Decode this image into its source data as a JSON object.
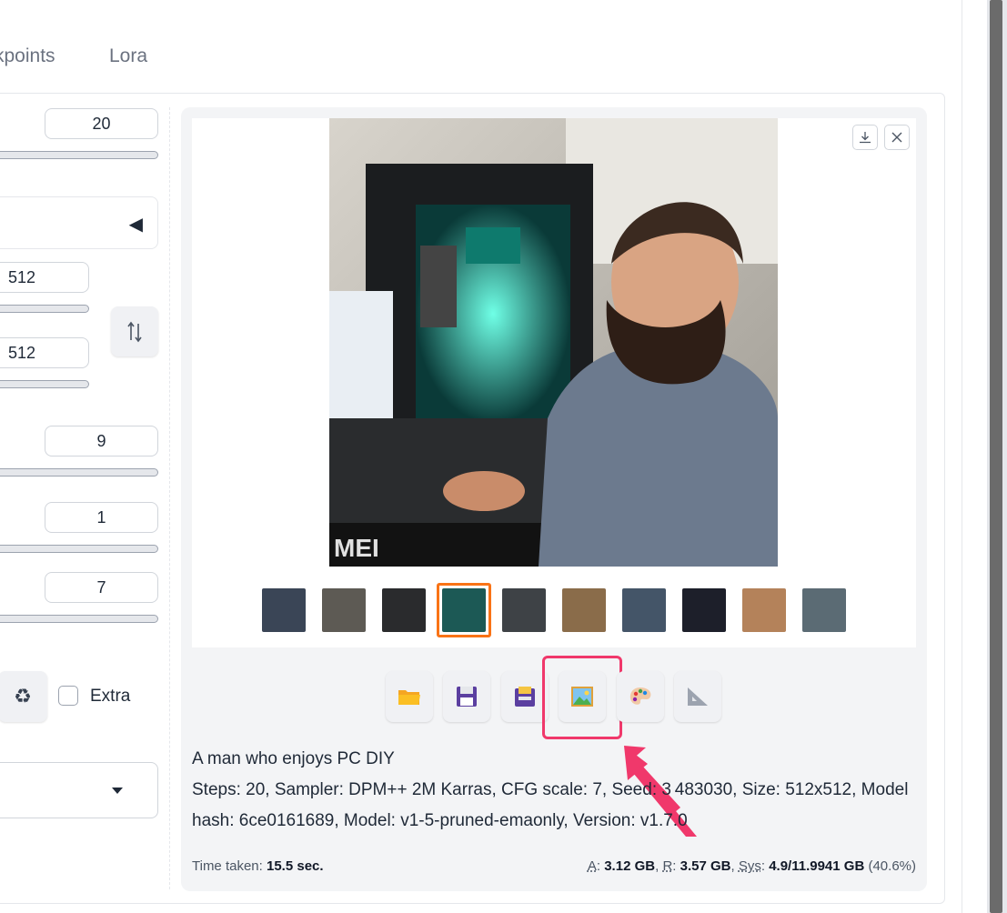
{
  "tabs": [
    {
      "label": "kpoints"
    },
    {
      "label": "Lora"
    }
  ],
  "params": {
    "steps": "20",
    "width": "512",
    "height": "512",
    "cfg": "9",
    "batch": "1",
    "seed_field": "7"
  },
  "extra": {
    "label": "Extra"
  },
  "output": {
    "prompt": "A man who enjoys PC DIY",
    "params_line1": "Steps: 20, Sampler: DPM++ 2M Karras, CFG scale: 7, Seed: 3 483030, Size: 512x512, Model",
    "params_line2": "hash: 6ce0161689, Model: v1-5-pruned-emaonly, Version: v1.7.0",
    "time_label": "Time taken:",
    "time_value": "15.5 sec.",
    "a_label": "A",
    "a_value": "3.12 GB",
    "r_label": "R",
    "r_value": "3.57 GB",
    "sys_label": "Sys",
    "sys_value": "4.9/11.9941 GB",
    "sys_pct": "(40.6%)"
  },
  "toolbar_icons": [
    "folder-icon",
    "save-icon",
    "zip-icon",
    "image-icon",
    "palette-icon",
    "ruler-icon"
  ],
  "thumbnails_count": 10,
  "selected_thumbnail": 4,
  "colors": {
    "accent_orange": "#f97316",
    "highlight_pink": "#f0386b"
  }
}
